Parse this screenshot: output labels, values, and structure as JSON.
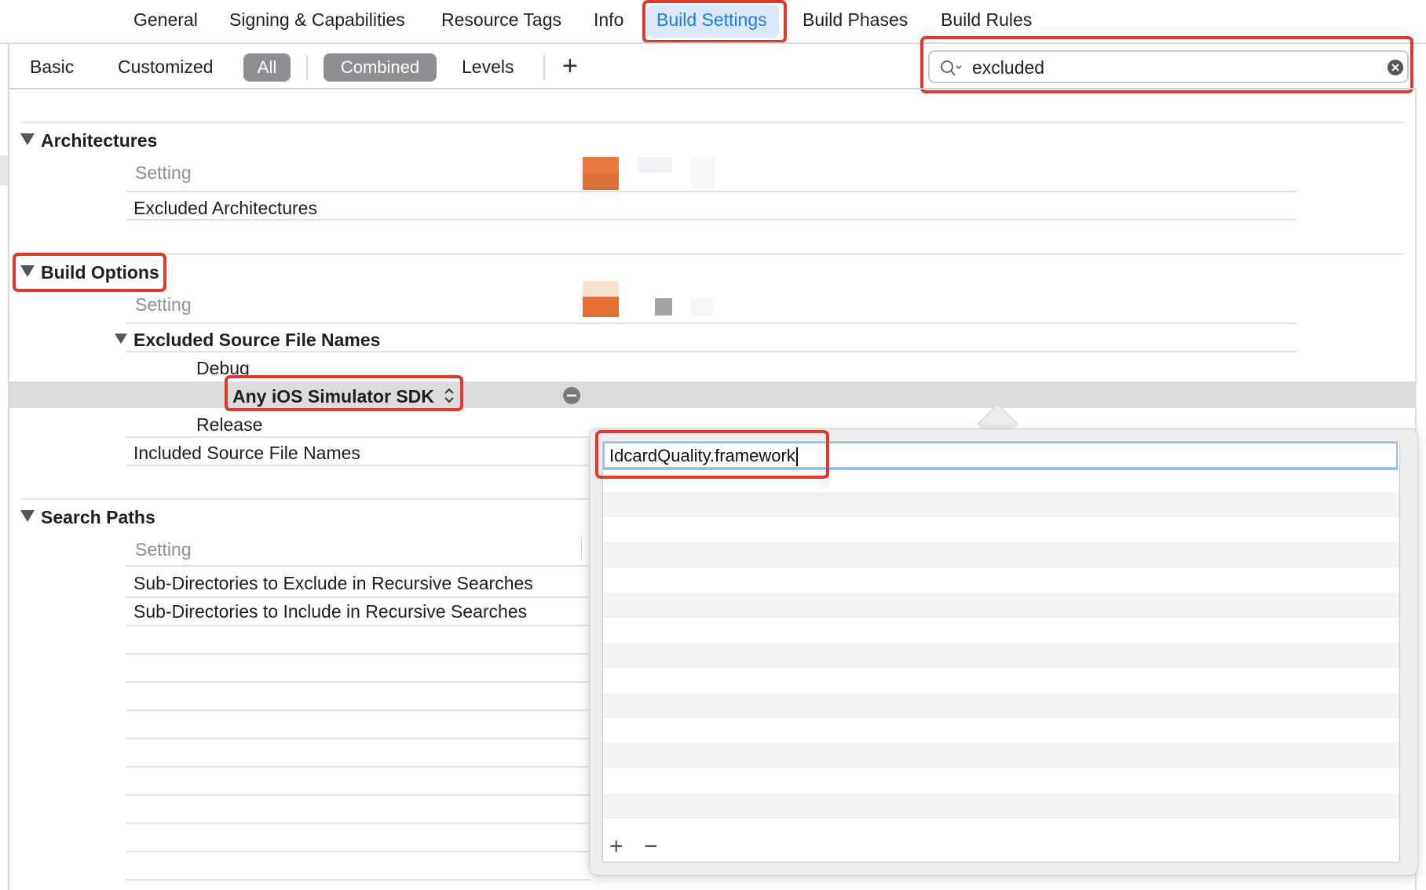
{
  "tabs": [
    "General",
    "Signing & Capabilities",
    "Resource Tags",
    "Info",
    "Build Settings",
    "Build Phases",
    "Build Rules"
  ],
  "active_tab": "Build Settings",
  "filters": {
    "basic": "Basic",
    "customized": "Customized",
    "all": "All",
    "combined": "Combined",
    "levels": "Levels",
    "add": "+"
  },
  "search": {
    "value": "excluded"
  },
  "sections": {
    "architectures": {
      "title": "Architectures",
      "setting_header": "Setting",
      "rows": [
        "Excluded Architectures"
      ]
    },
    "build_options": {
      "title": "Build Options",
      "setting_header": "Setting",
      "excluded_source": "Excluded Source File Names",
      "debug": "Debug",
      "sdk": "Any iOS Simulator SDK",
      "release": "Release",
      "included_source": "Included Source File Names"
    },
    "search_paths": {
      "title": "Search Paths",
      "setting_header": "Setting",
      "rows": [
        "Sub-Directories to Exclude in Recursive Searches",
        "Sub-Directories to Include in Recursive Searches"
      ]
    }
  },
  "popover": {
    "value": "IdcardQuality.framework",
    "add_button": "+",
    "remove_button": "−"
  },
  "colors": {
    "accent": "#1a7cf5",
    "highlight": "#e0392b",
    "pill": "#8e8e93"
  }
}
